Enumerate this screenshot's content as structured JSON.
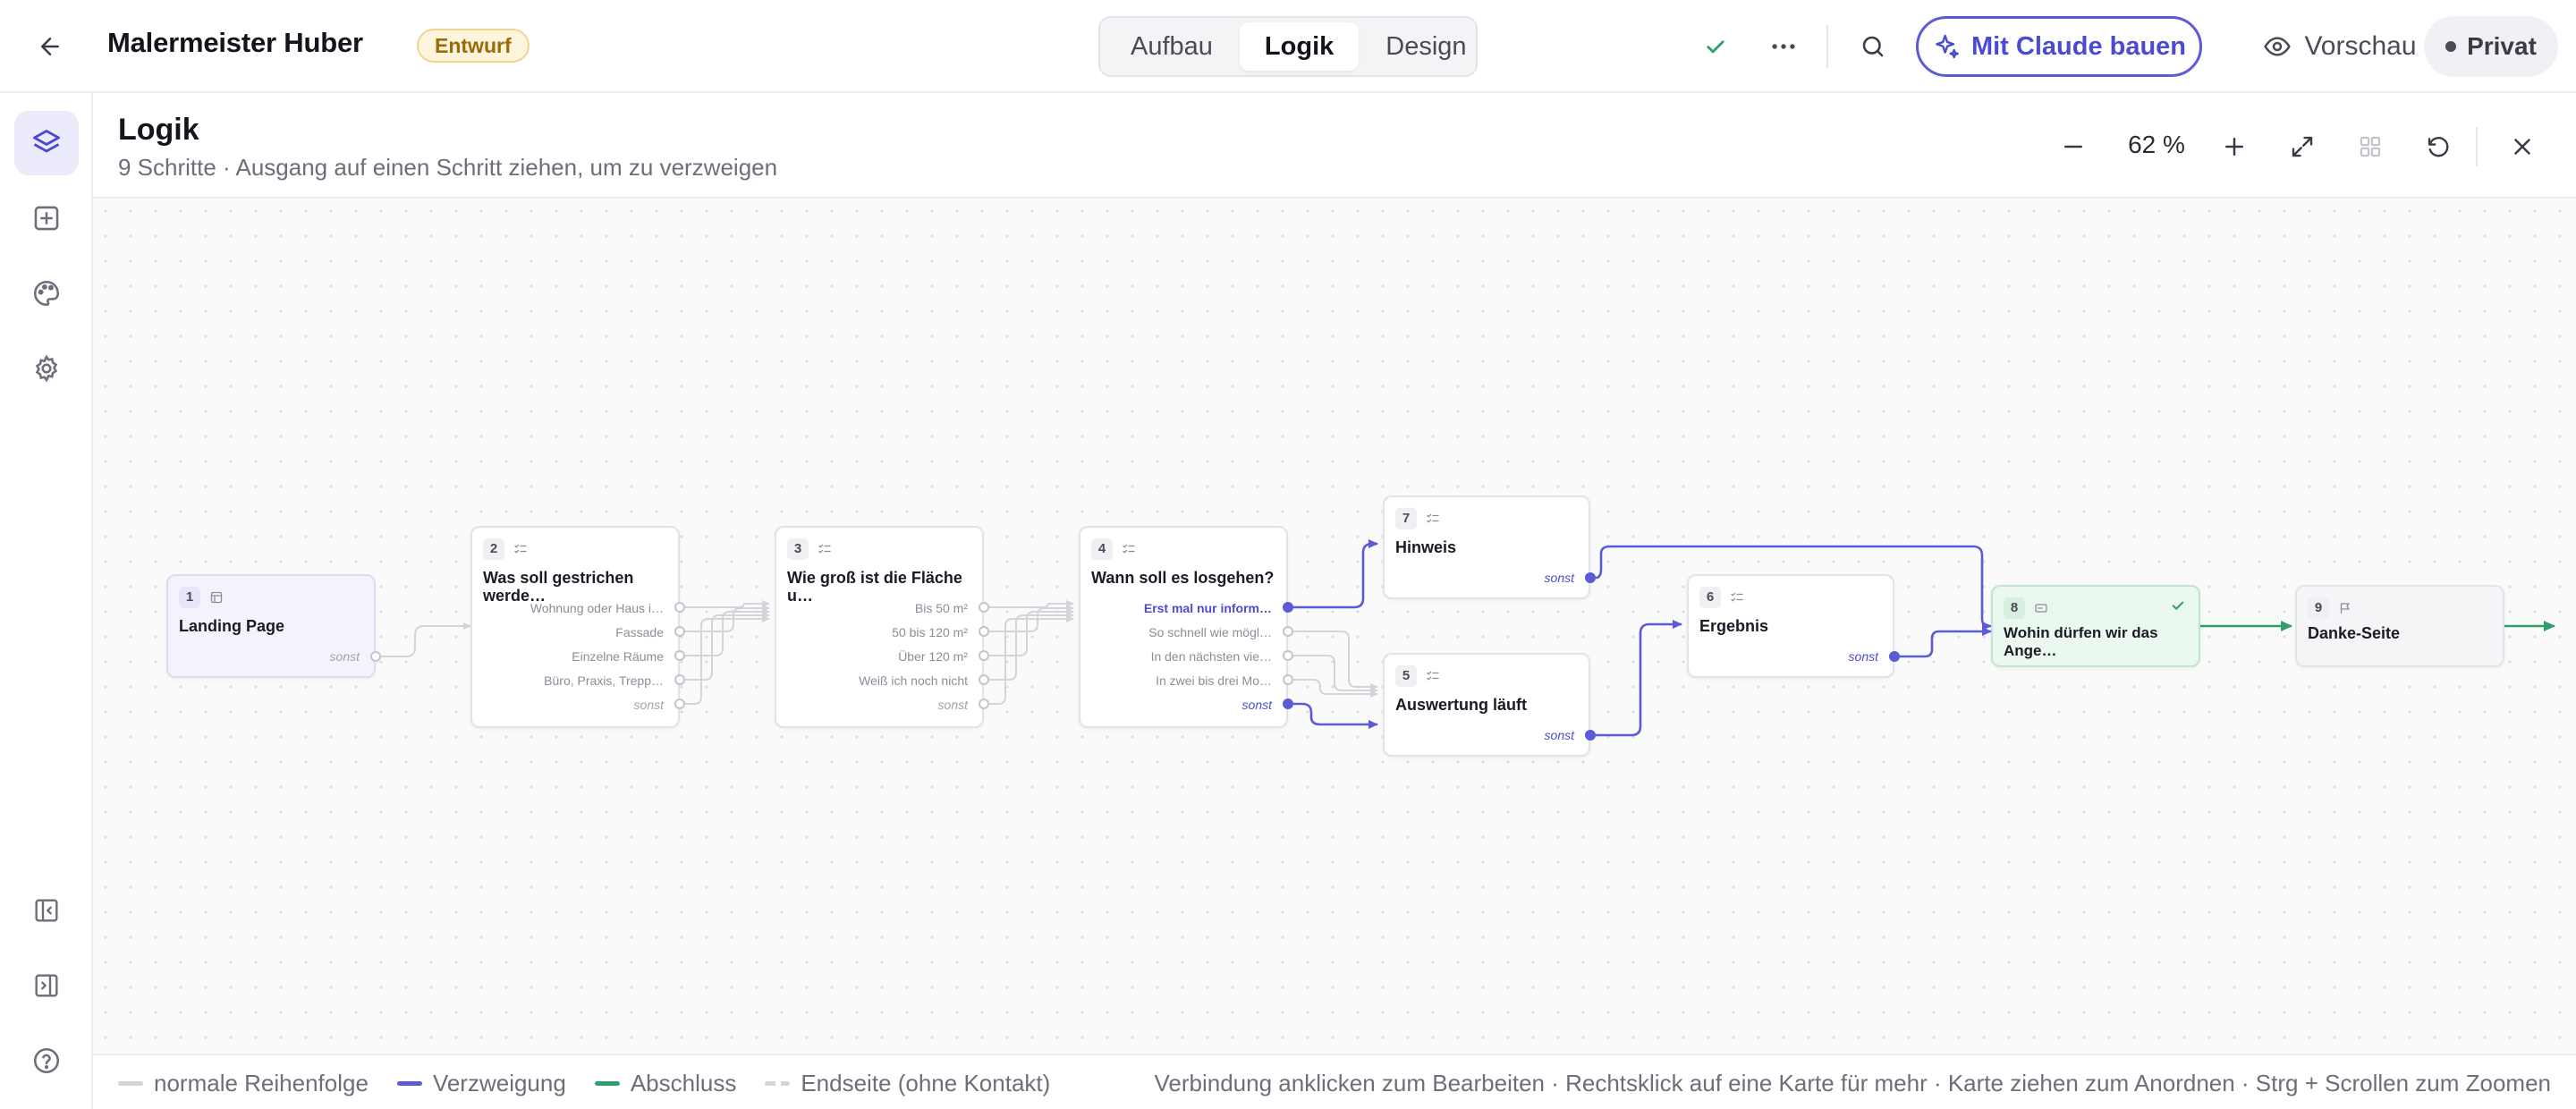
{
  "header": {
    "project_title": "Malermeister Huber",
    "status_badge": "Entwurf",
    "mode_tabs": [
      {
        "label": "Aufbau",
        "active": false
      },
      {
        "label": "Logik",
        "active": true
      },
      {
        "label": "Design",
        "active": false
      }
    ],
    "claude_button": "Mit Claude bauen",
    "preview_button": "Vorschau",
    "visibility_button": "Privat"
  },
  "sidebar": {
    "items": [
      {
        "icon": "layers-icon",
        "active": true
      },
      {
        "icon": "add-square-icon",
        "active": false
      },
      {
        "icon": "palette-icon",
        "active": false
      },
      {
        "icon": "gear-icon",
        "active": false
      }
    ],
    "bottom_items": [
      "collapse-left-icon",
      "expand-right-icon",
      "help-icon"
    ]
  },
  "panel": {
    "title": "Logik",
    "subtitle": "9 Schritte · Ausgang auf einen Schritt ziehen, um zu verzweigen",
    "zoom": "62 %"
  },
  "nodes": [
    {
      "id": "1",
      "title": "Landing Page",
      "icon": "layout-icon",
      "fallback": "sonst"
    },
    {
      "id": "2",
      "title": "Was soll gestrichen werde…",
      "icon": "choice-icon",
      "options": [
        "Wohnung oder Haus i…",
        "Fassade",
        "Einzelne Räume",
        "Büro, Praxis, Trepp…"
      ],
      "fallback": "sonst"
    },
    {
      "id": "3",
      "title": "Wie groß ist die Fläche u…",
      "icon": "choice-icon",
      "options": [
        "Bis 50 m²",
        "50 bis 120 m²",
        "Über 120 m²",
        "Weiß ich noch nicht"
      ],
      "fallback": "sonst"
    },
    {
      "id": "4",
      "title": "Wann soll es losgehen?",
      "icon": "choice-icon",
      "options": [
        "Erst mal nur inform…",
        "So schnell wie mögl…",
        "In den nächsten vie…",
        "In zwei bis drei Mo…"
      ],
      "fallback": "sonst"
    },
    {
      "id": "7",
      "title": "Hinweis",
      "icon": "choice-icon",
      "fallback": "sonst"
    },
    {
      "id": "5",
      "title": "Auswertung läuft",
      "icon": "choice-icon",
      "fallback": "sonst"
    },
    {
      "id": "6",
      "title": "Ergebnis",
      "icon": "choice-icon",
      "fallback": "sonst"
    },
    {
      "id": "8",
      "title": "Wohin dürfen wir das Ange…",
      "icon": "form-icon"
    },
    {
      "id": "9",
      "title": "Danke-Seite",
      "icon": "flag-icon"
    }
  ],
  "legend": [
    {
      "label": "normale Reihenfolge",
      "color": "#d4d4da"
    },
    {
      "label": "Verzweigung",
      "color": "#5b5bd6"
    },
    {
      "label": "Abschluss",
      "color": "#2f9e6b"
    },
    {
      "label": "Endseite (ohne Kontakt)",
      "color": "#d4d4da"
    }
  ],
  "hint": "Verbindung anklicken zum Bearbeiten · Rechtsklick auf eine Karte für mehr · Karte ziehen zum Anordnen · Strg + Scrollen zum Zoomen",
  "colors": {
    "accent": "#5b5bd6",
    "success": "#2f9e6b",
    "neutral_edge": "#d4d4da"
  }
}
